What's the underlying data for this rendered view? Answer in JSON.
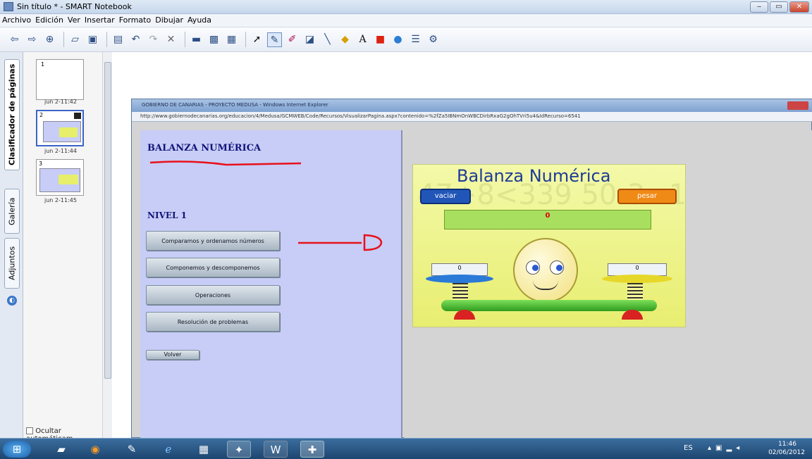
{
  "window": {
    "title": "Sin título * - SMART Notebook",
    "minimize": "‒",
    "maximize": "▭",
    "close": "✕"
  },
  "menu": [
    "Archivo",
    "Edición",
    "Ver",
    "Insertar",
    "Formato",
    "Dibujar",
    "Ayuda"
  ],
  "toolbar_icons": [
    "back-icon",
    "forward-icon",
    "add-page-icon",
    "open-icon",
    "save-icon",
    "paste-icon",
    "undo-icon",
    "redo-icon",
    "delete-icon",
    "screen-shade-icon",
    "full-screen-icon",
    "screen-capture-icon",
    "select-icon",
    "pen-icon",
    "creative-pen-icon",
    "eraser-icon",
    "line-icon",
    "shape-icon",
    "text-icon",
    "fill-icon",
    "gallery-icon",
    "table-icon",
    "settings-icon"
  ],
  "side_tabs": {
    "sorter": "Clasificador de páginas",
    "gallery": "Galería",
    "attachments": "Adjuntos"
  },
  "pages": [
    {
      "num": "1",
      "time": "jun 2-11:42"
    },
    {
      "num": "2",
      "time": "jun 2-11:44"
    },
    {
      "num": "3",
      "time": "jun 2-11:45"
    }
  ],
  "autohide_label": "Ocultar automáticam",
  "ie": {
    "title": "GOBIERNO DE CANARIAS - PROYECTO MEDUSA - Windows Internet Explorer",
    "url": "http://www.gobiernodecanarias.org/educacion/4/Medusa/GCMWEB/Code/Recursos/VisualizarPagina.aspx?contenido=%2fZa5IBNmOnWBCDirbRxaG2gOhTVri5u4&IdRecurso=6541"
  },
  "panel": {
    "heading": "BALANZA NUMÉRICA",
    "level": "NIVEL 1",
    "buttons": [
      "Comparamos y ordenamos números",
      "Componemos y descomponemos",
      "Operaciones",
      "Resolución de problemas"
    ],
    "back": "Volver"
  },
  "game": {
    "title": "Balanza Numérica",
    "empty_button": "vaciar",
    "weigh_button": "pesar",
    "result": "0",
    "left_plate": "0",
    "right_plate": "0",
    "bg_text": "47+8<339 50-3=12/6"
  },
  "taskbar": {
    "lang": "ES",
    "time": "11:46",
    "date": "02/06/2012"
  },
  "colors": {
    "heading": "#13147a",
    "ink": "#e8101a",
    "panel": "#c7cdf6",
    "vaciar": "#2156b8",
    "pesar": "#f08a16"
  }
}
